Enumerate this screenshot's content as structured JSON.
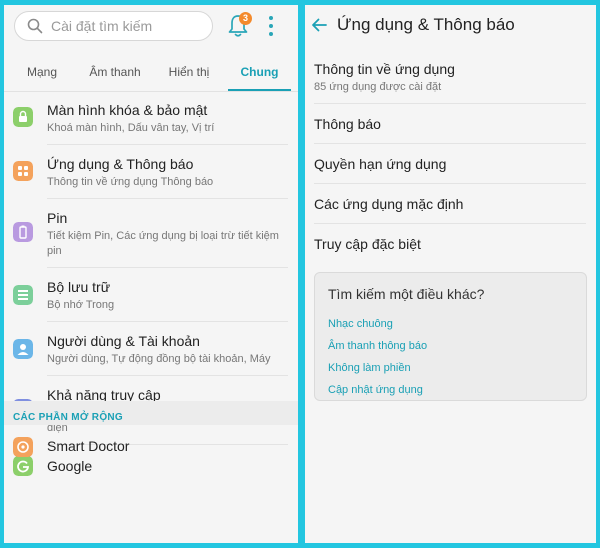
{
  "search": {
    "placeholder": "Cài đặt tìm kiếm",
    "notification_count": "3"
  },
  "tabs": [
    {
      "label": "Mạng"
    },
    {
      "label": "Âm thanh"
    },
    {
      "label": "Hiển thị"
    },
    {
      "label": "Chung",
      "active": true
    }
  ],
  "settings": [
    {
      "title": "Màn hình khóa & bảo mật",
      "subtitle": "Khoá màn hình, Dấu vân tay, Vị trí",
      "icon": "lock-icon",
      "color": "#8ccf6a"
    },
    {
      "title": "Ứng dụng & Thông báo",
      "subtitle": "Thông tin về ứng dụng Thông báo",
      "icon": "apps-icon",
      "color": "#f4a25c"
    },
    {
      "title": "Pin",
      "subtitle": "Tiết kiệm Pin, Các ứng dụng bị loại trừ tiết kiệm pin",
      "icon": "battery-icon",
      "color": "#b99ae0"
    },
    {
      "title": "Bộ lưu trữ",
      "subtitle": "Bộ nhớ Trong",
      "icon": "storage-icon",
      "color": "#7ccf9a"
    },
    {
      "title": "Người dùng & Tài khoản",
      "subtitle": "Người dùng, Tự động đồng bộ tài khoản, Máy",
      "icon": "user-icon",
      "color": "#6bb6e8"
    },
    {
      "title": "Khả năng truy cập",
      "subtitle": "Thị lực, Đang nghe, Khả năng vận động & nhận diện",
      "icon": "accessibility-icon",
      "color": "#7f8fe0"
    },
    {
      "title": "Google",
      "subtitle": "",
      "icon": "google-icon",
      "color": "#8ccf6a"
    }
  ],
  "extensions": {
    "header": "CÁC PHẦN MỞ RỘNG",
    "items": [
      {
        "title": "Smart Doctor",
        "icon": "smart-doctor-icon",
        "color": "#f4a25c"
      }
    ]
  },
  "detail": {
    "title": "Ứng dụng & Thông báo",
    "items": [
      {
        "title": "Thông tin về ứng dụng",
        "subtitle": "85 ứng dụng được cài đặt"
      },
      {
        "title": "Thông báo"
      },
      {
        "title": "Quyền hạn ứng dụng"
      },
      {
        "title": "Các ứng dụng mặc định"
      },
      {
        "title": "Truy cập đặc biệt"
      }
    ],
    "search_more": {
      "title": "Tìm kiếm một điều khác?",
      "links": [
        "Nhạc chuông",
        "Âm thanh thông báo",
        "Không làm phiền",
        "Cập nhật ứng dụng"
      ]
    }
  },
  "colors": {
    "accent": "#1aa0b5",
    "frame": "#23c6e0",
    "badge": "#f48a2c"
  }
}
